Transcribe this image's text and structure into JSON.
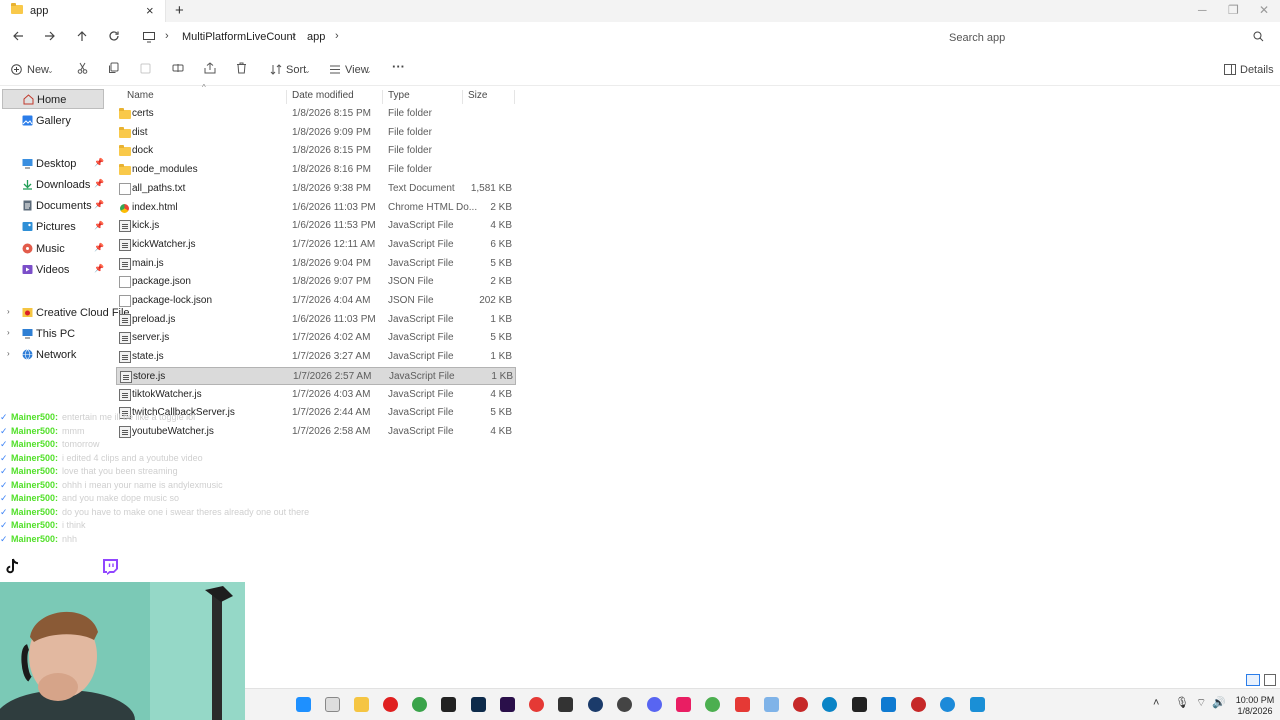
{
  "window": {
    "tab_title": "app",
    "new_tab": "+",
    "close_tab": "×"
  },
  "address": {
    "breadcrumbs": [
      "MultiPlatformLiveCount",
      "app"
    ],
    "search_placeholder": "Search app"
  },
  "commandbar": {
    "new_label": "New",
    "sort_label": "Sort",
    "view_label": "View",
    "more_label": "···",
    "details_label": "Details"
  },
  "sidebar": {
    "items": [
      {
        "label": "Home",
        "icon": "home-icon"
      },
      {
        "label": "Gallery",
        "icon": "gallery-icon"
      },
      {
        "label": "Desktop",
        "icon": "desktop-icon"
      },
      {
        "label": "Downloads",
        "icon": "downloads-icon"
      },
      {
        "label": "Documents",
        "icon": "documents-icon"
      },
      {
        "label": "Pictures",
        "icon": "pictures-icon"
      },
      {
        "label": "Music",
        "icon": "music-icon"
      },
      {
        "label": "Videos",
        "icon": "videos-icon"
      },
      {
        "label": "Creative Cloud File",
        "icon": "creative-cloud-icon"
      },
      {
        "label": "This PC",
        "icon": "this-pc-icon"
      },
      {
        "label": "Network",
        "icon": "network-icon"
      }
    ]
  },
  "filelist": {
    "columns": [
      "Name",
      "Date modified",
      "Type",
      "Size"
    ],
    "rows": [
      {
        "name": "certs",
        "date": "1/8/2026 8:15 PM",
        "type": "File folder",
        "size": "",
        "kind": "folder"
      },
      {
        "name": "dist",
        "date": "1/8/2026 9:09 PM",
        "type": "File folder",
        "size": "",
        "kind": "folder"
      },
      {
        "name": "dock",
        "date": "1/8/2026 8:15 PM",
        "type": "File folder",
        "size": "",
        "kind": "folder"
      },
      {
        "name": "node_modules",
        "date": "1/8/2026 8:16 PM",
        "type": "File folder",
        "size": "",
        "kind": "folder"
      },
      {
        "name": "all_paths.txt",
        "date": "1/8/2026 9:38 PM",
        "type": "Text Document",
        "size": "1,581 KB",
        "kind": "doc"
      },
      {
        "name": "index.html",
        "date": "1/6/2026 11:03 PM",
        "type": "Chrome HTML Do...",
        "size": "2 KB",
        "kind": "html"
      },
      {
        "name": "kick.js",
        "date": "1/6/2026 11:53 PM",
        "type": "JavaScript File",
        "size": "4 KB",
        "kind": "js"
      },
      {
        "name": "kickWatcher.js",
        "date": "1/7/2026 12:11 AM",
        "type": "JavaScript File",
        "size": "6 KB",
        "kind": "js"
      },
      {
        "name": "main.js",
        "date": "1/8/2026 9:04 PM",
        "type": "JavaScript File",
        "size": "5 KB",
        "kind": "js"
      },
      {
        "name": "package.json",
        "date": "1/8/2026 9:07 PM",
        "type": "JSON File",
        "size": "2 KB",
        "kind": "doc"
      },
      {
        "name": "package-lock.json",
        "date": "1/7/2026 4:04 AM",
        "type": "JSON File",
        "size": "202 KB",
        "kind": "doc"
      },
      {
        "name": "preload.js",
        "date": "1/6/2026 11:03 PM",
        "type": "JavaScript File",
        "size": "1 KB",
        "kind": "js"
      },
      {
        "name": "server.js",
        "date": "1/7/2026 4:02 AM",
        "type": "JavaScript File",
        "size": "5 KB",
        "kind": "js"
      },
      {
        "name": "state.js",
        "date": "1/7/2026 3:27 AM",
        "type": "JavaScript File",
        "size": "1 KB",
        "kind": "js"
      },
      {
        "name": "store.js",
        "date": "1/7/2026 2:57 AM",
        "type": "JavaScript File",
        "size": "1 KB",
        "kind": "js",
        "selected": true
      },
      {
        "name": "tiktokWatcher.js",
        "date": "1/7/2026 4:03 AM",
        "type": "JavaScript File",
        "size": "4 KB",
        "kind": "js"
      },
      {
        "name": "twitchCallbackServer.js",
        "date": "1/7/2026 2:44 AM",
        "type": "JavaScript File",
        "size": "5 KB",
        "kind": "js"
      },
      {
        "name": "youtubeWatcher.js",
        "date": "1/7/2026 2:58 AM",
        "type": "JavaScript File",
        "size": "4 KB",
        "kind": "js"
      }
    ]
  },
  "chat": {
    "lines": [
      {
        "user": "Mainer500:",
        "msg": "entertain me ill be like a toggle lol"
      },
      {
        "user": "Mainer500:",
        "msg": "mmm"
      },
      {
        "user": "Mainer500:",
        "msg": "tomorrow"
      },
      {
        "user": "Mainer500:",
        "msg": "i edited 4 clips and a youtube video"
      },
      {
        "user": "Mainer500:",
        "msg": "love that you been streaming"
      },
      {
        "user": "Mainer500:",
        "msg": "ohhh i mean your name is andylexmusic"
      },
      {
        "user": "Mainer500:",
        "msg": "and you make dope music so"
      },
      {
        "user": "Mainer500:",
        "msg": "do you have to make one i swear theres already one out there"
      },
      {
        "user": "Mainer500:",
        "msg": "i think"
      },
      {
        "user": "Mainer500:",
        "msg": "nhh"
      }
    ]
  },
  "taskbar": {
    "time": "10:00 PM",
    "date": "1/8/2026"
  }
}
